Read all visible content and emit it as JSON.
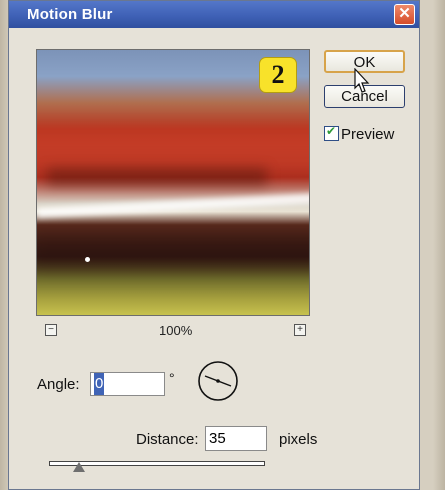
{
  "dialog": {
    "title": "Motion Blur",
    "close_icon": "close-icon"
  },
  "annotation": {
    "step_number": "2"
  },
  "buttons": {
    "ok_label": "OK",
    "cancel_label": "Cancel"
  },
  "preview_option": {
    "label": "Preview",
    "checked": true
  },
  "zoom": {
    "level": "100%",
    "minus_icon": "zoom-out-icon",
    "plus_icon": "zoom-in-icon"
  },
  "angle": {
    "label": "Angle:",
    "value": "0",
    "unit": "°"
  },
  "distance": {
    "label": "Distance:",
    "value": "35",
    "unit": "pixels",
    "slider_fraction": 0.14
  },
  "colors": {
    "title_bar": "#3f61b6",
    "close_button": "#d54c2a",
    "ok_border": "#d7a34a",
    "badge": "#f8e22a"
  }
}
